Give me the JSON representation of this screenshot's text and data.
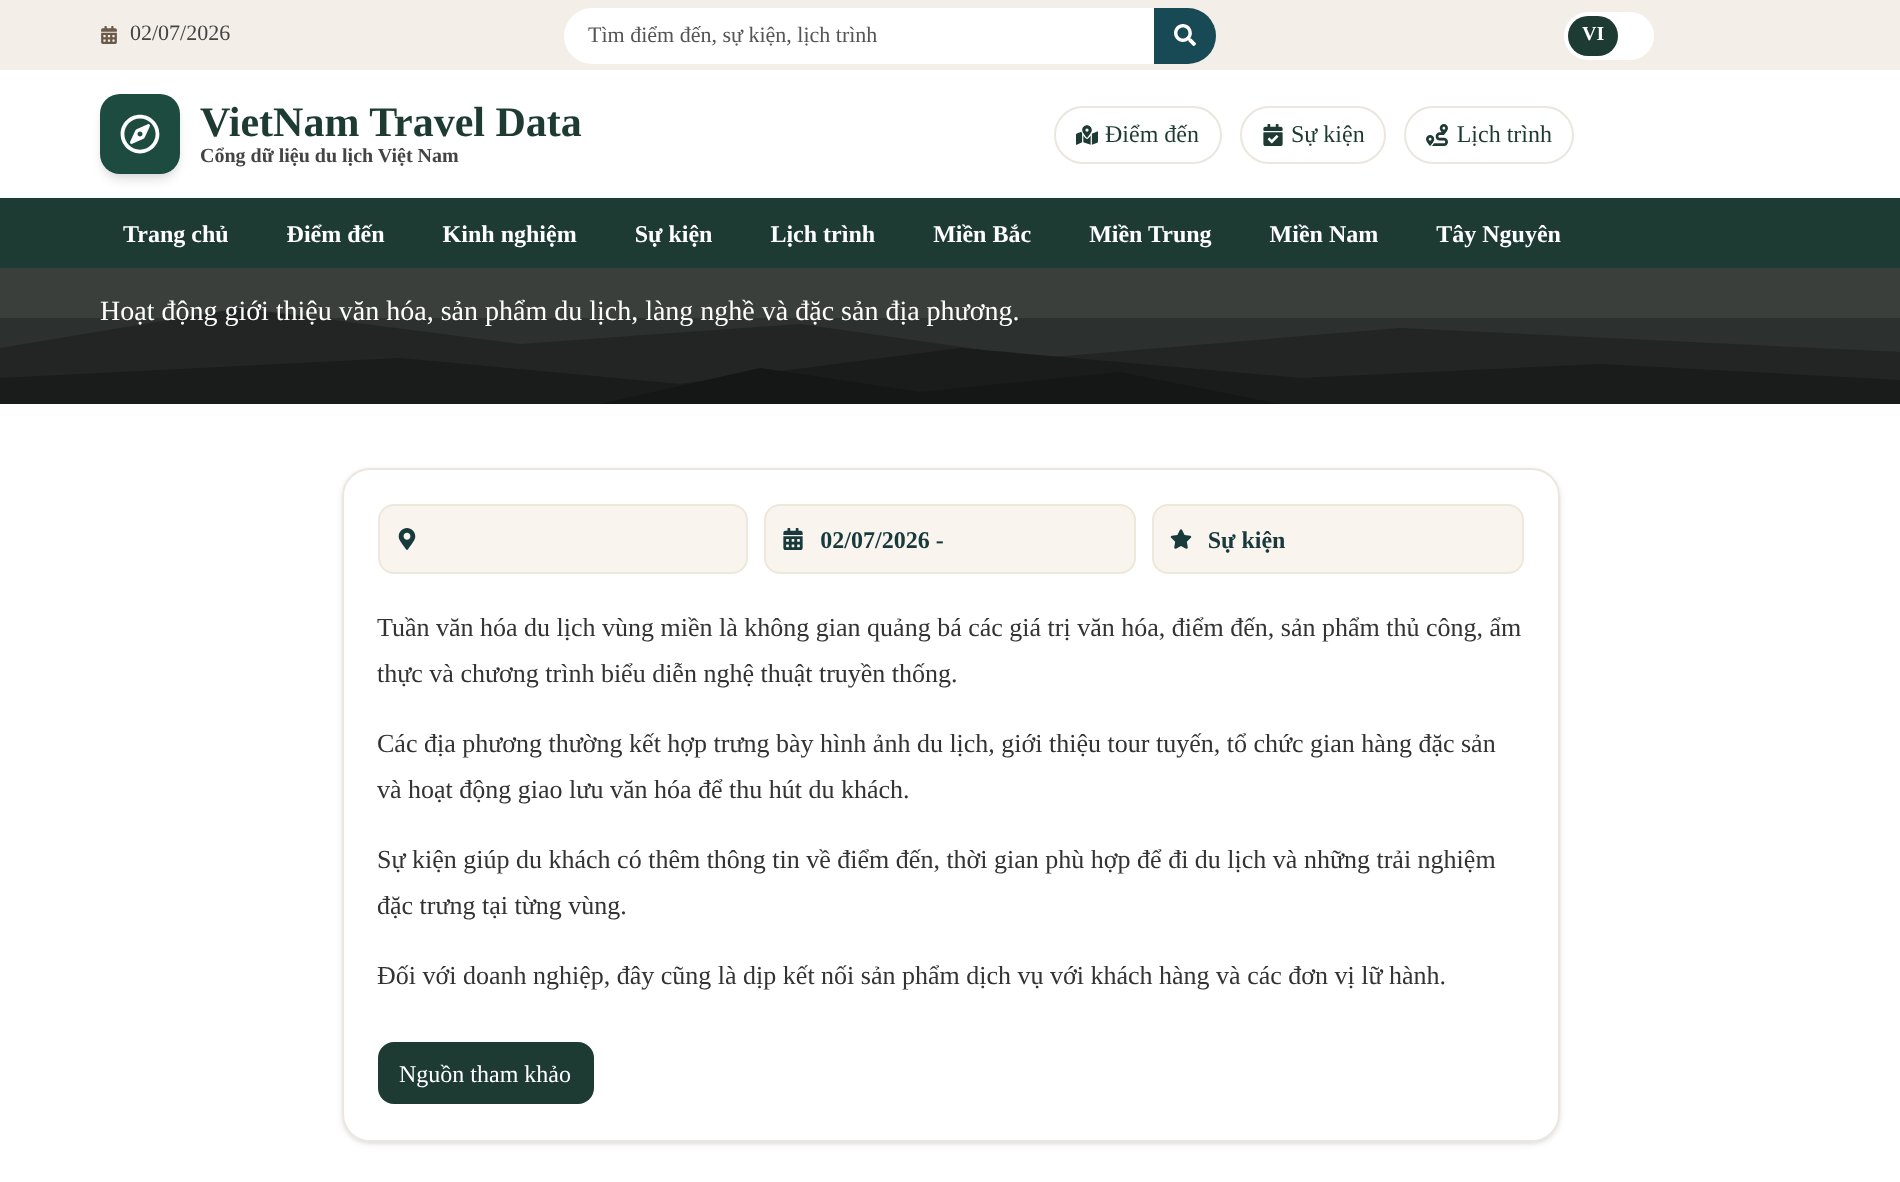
{
  "topbar": {
    "date": "02/07/2026",
    "search": {
      "placeholder": "Tìm điểm đến, sự kiện, lịch trình"
    },
    "languages": [
      {
        "label": "VI",
        "selected": true
      }
    ]
  },
  "header": {
    "title": "VietNam Travel Data",
    "subtitle": "Cổng dữ liệu du lịch Việt Nam",
    "links": [
      {
        "label": "Điểm đến",
        "kind": "map"
      },
      {
        "label": "Sự kiện",
        "kind": "calendar"
      },
      {
        "label": "Lịch trình",
        "kind": "route"
      }
    ]
  },
  "nav": {
    "items": [
      {
        "label": "Trang chủ",
        "selected": false
      },
      {
        "label": "Điểm đến",
        "selected": false
      },
      {
        "label": "Kinh nghiệm",
        "selected": false
      },
      {
        "label": "Sự kiện",
        "selected": false
      },
      {
        "label": "Lịch trình",
        "selected": false
      },
      {
        "label": "Miền Bắc",
        "selected": false
      },
      {
        "label": "Miền Trung",
        "selected": false
      },
      {
        "label": "Miền Nam",
        "selected": false
      },
      {
        "label": "Tây Nguyên",
        "selected": false
      }
    ]
  },
  "hero": {
    "kind": "picture",
    "description": "Hoạt động giới thiệu văn hóa, sản phẩm du lịch, làng nghề và đặc sản địa phương."
  },
  "article": {
    "meta": [
      {
        "kind": "location"
      },
      {
        "kind": "date",
        "text": "02/07/2026 -"
      },
      {
        "kind": "category",
        "text": "Sự kiện"
      }
    ],
    "paragraphs": [
      "Tuần văn hóa du lịch vùng miền là không gian quảng bá các giá trị văn hóa, điểm đến, sản phẩm thủ công, ẩm thực và chương trình biểu diễn nghệ thuật truyền thống.",
      "Các địa phương thường kết hợp trưng bày hình ảnh du lịch, giới thiệu tour tuyến, tổ chức gian hàng đặc sản và hoạt động giao lưu văn hóa để thu hút du khách.",
      "Sự kiện giúp du khách có thêm thông tin về điểm đến, thời gian phù hợp để đi du lịch và những trải nghiệm đặc trưng tại từng vùng.",
      "Đối với doanh nghiệp, đây cũng là dịp kết nối sản phẩm dịch vụ với khách hàng và các đơn vị lữ hành."
    ],
    "button": "Nguồn tham khảo"
  }
}
